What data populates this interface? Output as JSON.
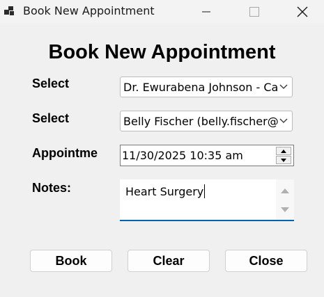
{
  "window": {
    "title": "Book New Appointment",
    "icons": {
      "app": "app-icon",
      "minimize": "minimize-icon",
      "maximize": "maximize-icon",
      "close": "close-icon"
    }
  },
  "form": {
    "heading": "Book New Appointment",
    "doctor": {
      "label": "Select",
      "value": "Dr. Ewurabena Johnson - Ca"
    },
    "patient": {
      "label": "Select",
      "value": "Belly Fischer (belly.fischer@e"
    },
    "appointment": {
      "label": "Appointme",
      "value": "11/30/2025 10:35 am"
    },
    "notes": {
      "label": "Notes:",
      "value": "Heart Surgery"
    }
  },
  "buttons": {
    "book": "Book",
    "clear": "Clear",
    "close": "Close"
  },
  "colors": {
    "background": "#f0f0f0",
    "focus_accent": "#0063b1",
    "input_bg": "#ffffff"
  }
}
